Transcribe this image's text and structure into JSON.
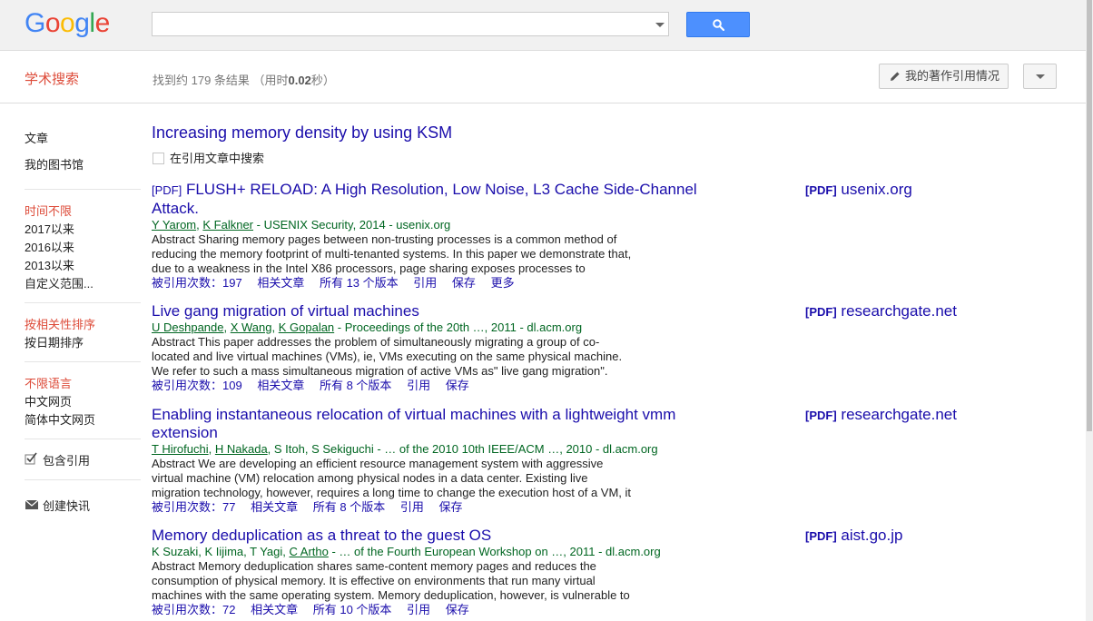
{
  "header": {
    "logo_letters": [
      {
        "ch": "G",
        "color": "#4285f4"
      },
      {
        "ch": "o",
        "color": "#ea4335"
      },
      {
        "ch": "o",
        "color": "#fbbc05"
      },
      {
        "ch": "g",
        "color": "#4285f4"
      },
      {
        "ch": "l",
        "color": "#34a853"
      },
      {
        "ch": "e",
        "color": "#ea4335"
      }
    ],
    "search_value": "",
    "search_button_icon": "search-icon"
  },
  "toolbar": {
    "section_label": "学术搜索",
    "results_prefix": "找到约 179 条结果 （用时",
    "results_time": "0.02",
    "results_suffix": "秒）",
    "my_citations_label": "我的著作引用情况"
  },
  "sidebar": {
    "articles": "文章",
    "my_library": "我的图书馆",
    "time_any": "时间不限",
    "since_2017": "2017以来",
    "since_2016": "2016以来",
    "since_2013": "2013以来",
    "custom_range": "自定义范围...",
    "sort_relevance": "按相关性排序",
    "sort_date": "按日期排序",
    "lang_any": "不限语言",
    "lang_chinese": "中文网页",
    "lang_simplified": "简体中文网页",
    "include_citations": "包含引用",
    "create_alert": "创建快讯"
  },
  "main": {
    "query_title": "Increasing memory density by using KSM",
    "search_within_label": "在引用文章中搜索"
  },
  "results": [
    {
      "tag": "[PDF]",
      "title_line1": "FLUSH+ RELOAD: A High Resolution, Low Noise, L3 Cache Side-Channel",
      "title_line2": "Attack.",
      "author1": "Y Yarom",
      "sep1": ", ",
      "author2": "K Falkner",
      "venue": " - USENIX Security, 2014 - usenix.org",
      "abs1": "Abstract Sharing memory pages between non-trusting processes is a common method of",
      "abs2": "reducing the memory footprint of multi-tenanted systems. In this paper we demonstrate that,",
      "abs3": "due to a weakness in the Intel X86 processors, page sharing exposes processes to",
      "cited": "被引用次数：197",
      "related": "相关文章",
      "versions": "所有 13 个版本",
      "cite": "引用",
      "save": "保存",
      "more": "更多",
      "pdf_tag": "[PDF]",
      "pdf_source": "usenix.org"
    },
    {
      "title": "Live gang migration of virtual machines",
      "author1": "U Deshpande",
      "author2": "X Wang",
      "author3": "K Gopalan",
      "venue": " - Proceedings of the 20th …, 2011 - dl.acm.org",
      "abs1": "Abstract This paper addresses the problem of simultaneously migrating a group of co-",
      "abs2": "located and live virtual machines (VMs), ie, VMs executing on the same physical machine.",
      "abs3": "We refer to such a mass simultaneous migration of active VMs as\" live gang migration\".",
      "cited": "被引用次数：109",
      "related": "相关文章",
      "versions": "所有 8 个版本",
      "cite": "引用",
      "save": "保存",
      "pdf_tag": "[PDF]",
      "pdf_source": "researchgate.net"
    },
    {
      "title_line1": "Enabling instantaneous relocation of virtual machines with a lightweight vmm",
      "title_line2": "extension",
      "author1": "T Hirofuchi",
      "author2": "H Nakada",
      "venue": ", S Itoh, S Sekiguchi - … of the 2010 10th IEEE/ACM …, 2010 - dl.acm.org",
      "abs1": "Abstract We are developing an efficient resource management system with aggressive",
      "abs2": "virtual machine (VM) relocation among physical nodes in a data center. Existing live",
      "abs3": "migration technology, however, requires a long time to change the execution host of a VM, it",
      "cited": "被引用次数：77",
      "related": "相关文章",
      "versions": "所有 8 个版本",
      "cite": "引用",
      "save": "保存",
      "pdf_tag": "[PDF]",
      "pdf_source": "researchgate.net"
    },
    {
      "title": "Memory deduplication as a threat to the guest OS",
      "authors_plain": "K Suzaki, K Iijima, T Yagi, ",
      "author_link": "C Artho",
      "venue": " - … of the Fourth European Workshop on …, 2011 - dl.acm.org",
      "abs1": "Abstract Memory deduplication shares same-content memory pages and reduces the",
      "abs2": "consumption of physical memory. It is effective on environments that run many virtual",
      "abs3": "machines with the same operating system. Memory deduplication, however, is vulnerable to",
      "cited": "被引用次数：72",
      "related": "相关文章",
      "versions": "所有 10 个版本",
      "cite": "引用",
      "save": "保存",
      "pdf_tag": "[PDF]",
      "pdf_source": "aist.go.jp"
    }
  ]
}
